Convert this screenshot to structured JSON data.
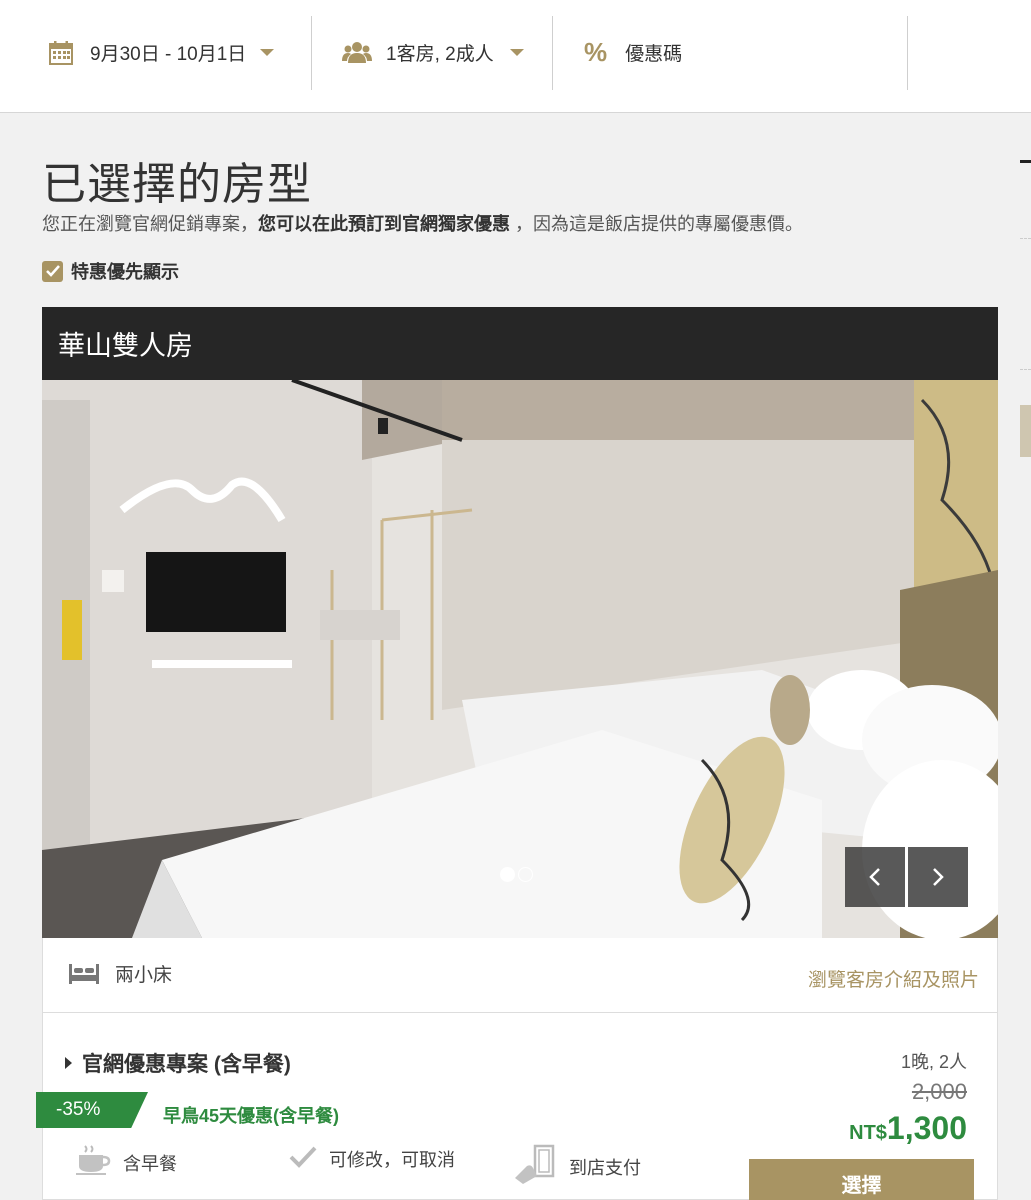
{
  "booking_bar": {
    "dates": "9月30日 - 10月1日",
    "guests": "1客房, 2成人",
    "promo_code": "優惠碼"
  },
  "section": {
    "title": "已選擇的房型",
    "subtitle_pre": "您正在瀏覽官網促銷專案，",
    "subtitle_bold": "您可以在此預訂到官網獨家優惠",
    "subtitle_post": " ，因為這是飯店提供的專屬優惠價。",
    "filter_label": "特惠優先顯示",
    "filter_checked": true
  },
  "room": {
    "name": "華山雙人房",
    "bed_type": "兩小床",
    "details_link": "瀏覽客房介紹及照片",
    "carousel": {
      "total": 2,
      "current": 1
    }
  },
  "rate_plan": {
    "name": "官網優惠專案 (含早餐)",
    "discount_badge": "-35%",
    "promo_label": "早鳥45天優惠(含早餐)",
    "features": [
      "含早餐",
      "可修改，可取消",
      "到店支付"
    ],
    "stay_info": "1晚, 2人",
    "original_price": "2,000",
    "currency": "NT$",
    "price": "1,300",
    "select_label": "選擇"
  },
  "colors": {
    "accent_gold": "#a89463",
    "discount_green": "#2e8b3f",
    "header_dark": "#262626"
  }
}
